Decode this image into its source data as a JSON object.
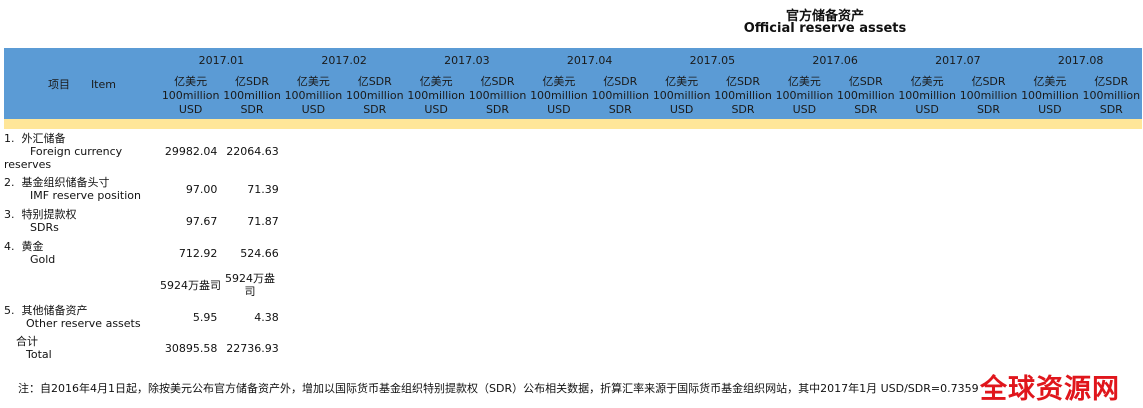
{
  "title_zh": "官方储备资产",
  "title_en": "Official reserve assets",
  "header": {
    "item_zh": "项目",
    "item_en": "Item",
    "months": [
      "2017.01",
      "2017.02",
      "2017.03",
      "2017.04",
      "2017.05",
      "2017.06",
      "2017.07",
      "2017.08"
    ],
    "unit_usd": [
      "亿美元",
      "100million",
      "USD"
    ],
    "unit_sdr": [
      "亿SDR",
      "100million",
      "SDR"
    ]
  },
  "rows": [
    {
      "no": "1.",
      "zh": "外汇储备",
      "en": "Foreign currency",
      "en2": "reserves",
      "usd": "29982.04",
      "sdr": "22064.63"
    },
    {
      "no": "2.",
      "zh": "基金组织储备头寸",
      "en": "IMF reserve position",
      "usd": "97.00",
      "sdr": "71.39"
    },
    {
      "no": "3.",
      "zh": "特别提款权",
      "en": "SDRs",
      "usd": "97.67",
      "sdr": "71.87"
    },
    {
      "no": "4.",
      "zh": "黄金",
      "en": "Gold",
      "usd": "712.92",
      "sdr": "524.66"
    },
    {
      "no": "",
      "zh": "",
      "en": "",
      "usd": "5924万盎司",
      "sdr_a": "5924万盎",
      "sdr_b": "司"
    },
    {
      "no": "5.",
      "zh": "其他储备资产",
      "en": "Other reserve assets",
      "usd": "5.95",
      "sdr": "4.38"
    },
    {
      "no": "",
      "zh": "合计",
      "en": "Total",
      "usd": "30895.58",
      "sdr": "22736.93"
    }
  ],
  "footnote": "注：自2016年4月1日起，除按美元公布官方储备资产外，增加以国际货币基金组织特别提款权（SDR）公布相关数据，折算汇率来源于国际货币基金组织网站，其中2017年1月 USD/SDR=0.7359",
  "watermark": "全球资源网"
}
